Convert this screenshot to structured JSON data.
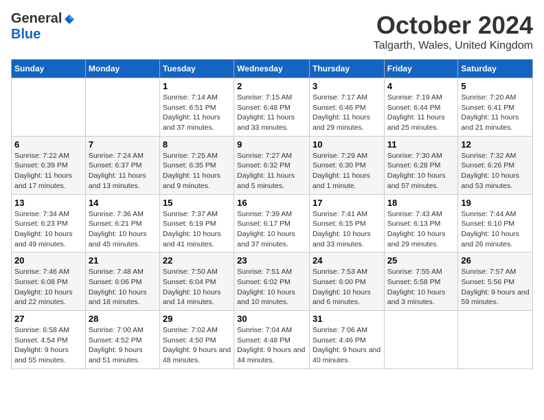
{
  "logo": {
    "general": "General",
    "blue": "Blue"
  },
  "title": "October 2024",
  "location": "Talgarth, Wales, United Kingdom",
  "headers": [
    "Sunday",
    "Monday",
    "Tuesday",
    "Wednesday",
    "Thursday",
    "Friday",
    "Saturday"
  ],
  "weeks": [
    [
      {
        "day": "",
        "info": ""
      },
      {
        "day": "",
        "info": ""
      },
      {
        "day": "1",
        "info": "Sunrise: 7:14 AM\nSunset: 6:51 PM\nDaylight: 11 hours\nand 37 minutes."
      },
      {
        "day": "2",
        "info": "Sunrise: 7:15 AM\nSunset: 6:48 PM\nDaylight: 11 hours\nand 33 minutes."
      },
      {
        "day": "3",
        "info": "Sunrise: 7:17 AM\nSunset: 6:46 PM\nDaylight: 11 hours\nand 29 minutes."
      },
      {
        "day": "4",
        "info": "Sunrise: 7:19 AM\nSunset: 6:44 PM\nDaylight: 11 hours\nand 25 minutes."
      },
      {
        "day": "5",
        "info": "Sunrise: 7:20 AM\nSunset: 6:41 PM\nDaylight: 11 hours\nand 21 minutes."
      }
    ],
    [
      {
        "day": "6",
        "info": "Sunrise: 7:22 AM\nSunset: 6:39 PM\nDaylight: 11 hours\nand 17 minutes."
      },
      {
        "day": "7",
        "info": "Sunrise: 7:24 AM\nSunset: 6:37 PM\nDaylight: 11 hours\nand 13 minutes."
      },
      {
        "day": "8",
        "info": "Sunrise: 7:25 AM\nSunset: 6:35 PM\nDaylight: 11 hours\nand 9 minutes."
      },
      {
        "day": "9",
        "info": "Sunrise: 7:27 AM\nSunset: 6:32 PM\nDaylight: 11 hours\nand 5 minutes."
      },
      {
        "day": "10",
        "info": "Sunrise: 7:29 AM\nSunset: 6:30 PM\nDaylight: 11 hours\nand 1 minute."
      },
      {
        "day": "11",
        "info": "Sunrise: 7:30 AM\nSunset: 6:28 PM\nDaylight: 10 hours\nand 57 minutes."
      },
      {
        "day": "12",
        "info": "Sunrise: 7:32 AM\nSunset: 6:26 PM\nDaylight: 10 hours\nand 53 minutes."
      }
    ],
    [
      {
        "day": "13",
        "info": "Sunrise: 7:34 AM\nSunset: 6:23 PM\nDaylight: 10 hours\nand 49 minutes."
      },
      {
        "day": "14",
        "info": "Sunrise: 7:36 AM\nSunset: 6:21 PM\nDaylight: 10 hours\nand 45 minutes."
      },
      {
        "day": "15",
        "info": "Sunrise: 7:37 AM\nSunset: 6:19 PM\nDaylight: 10 hours\nand 41 minutes."
      },
      {
        "day": "16",
        "info": "Sunrise: 7:39 AM\nSunset: 6:17 PM\nDaylight: 10 hours\nand 37 minutes."
      },
      {
        "day": "17",
        "info": "Sunrise: 7:41 AM\nSunset: 6:15 PM\nDaylight: 10 hours\nand 33 minutes."
      },
      {
        "day": "18",
        "info": "Sunrise: 7:43 AM\nSunset: 6:13 PM\nDaylight: 10 hours\nand 29 minutes."
      },
      {
        "day": "19",
        "info": "Sunrise: 7:44 AM\nSunset: 6:10 PM\nDaylight: 10 hours\nand 26 minutes."
      }
    ],
    [
      {
        "day": "20",
        "info": "Sunrise: 7:46 AM\nSunset: 6:08 PM\nDaylight: 10 hours\nand 22 minutes."
      },
      {
        "day": "21",
        "info": "Sunrise: 7:48 AM\nSunset: 6:06 PM\nDaylight: 10 hours\nand 18 minutes."
      },
      {
        "day": "22",
        "info": "Sunrise: 7:50 AM\nSunset: 6:04 PM\nDaylight: 10 hours\nand 14 minutes."
      },
      {
        "day": "23",
        "info": "Sunrise: 7:51 AM\nSunset: 6:02 PM\nDaylight: 10 hours\nand 10 minutes."
      },
      {
        "day": "24",
        "info": "Sunrise: 7:53 AM\nSunset: 6:00 PM\nDaylight: 10 hours\nand 6 minutes."
      },
      {
        "day": "25",
        "info": "Sunrise: 7:55 AM\nSunset: 5:58 PM\nDaylight: 10 hours\nand 3 minutes."
      },
      {
        "day": "26",
        "info": "Sunrise: 7:57 AM\nSunset: 5:56 PM\nDaylight: 9 hours\nand 59 minutes."
      }
    ],
    [
      {
        "day": "27",
        "info": "Sunrise: 6:58 AM\nSunset: 4:54 PM\nDaylight: 9 hours\nand 55 minutes."
      },
      {
        "day": "28",
        "info": "Sunrise: 7:00 AM\nSunset: 4:52 PM\nDaylight: 9 hours\nand 51 minutes."
      },
      {
        "day": "29",
        "info": "Sunrise: 7:02 AM\nSunset: 4:50 PM\nDaylight: 9 hours\nand 48 minutes."
      },
      {
        "day": "30",
        "info": "Sunrise: 7:04 AM\nSunset: 4:48 PM\nDaylight: 9 hours\nand 44 minutes."
      },
      {
        "day": "31",
        "info": "Sunrise: 7:06 AM\nSunset: 4:46 PM\nDaylight: 9 hours\nand 40 minutes."
      },
      {
        "day": "",
        "info": ""
      },
      {
        "day": "",
        "info": ""
      }
    ]
  ]
}
